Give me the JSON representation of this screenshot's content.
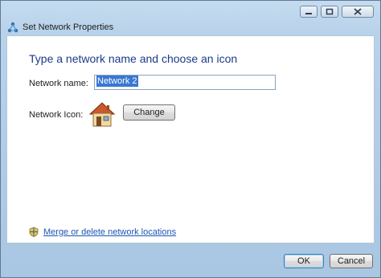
{
  "window": {
    "title": "Set Network Properties",
    "controls": [
      "minimize-icon",
      "restore-icon",
      "close-icon"
    ]
  },
  "main": {
    "heading": "Type a network name and choose an icon",
    "network_name_label": "Network name:",
    "network_name_value": "Network  2",
    "network_icon_label": "Network Icon:",
    "network_icon": "home-network-icon",
    "change_button": "Change",
    "merge_link": "Merge or delete network locations",
    "merge_link_icon": "shield-icon"
  },
  "footer": {
    "ok_label": "OK",
    "cancel_label": "Cancel"
  },
  "colors": {
    "heading": "#1c3a8a",
    "link": "#1a56b5",
    "selection": "#3a77d1",
    "chrome": "#b8d2ea"
  }
}
